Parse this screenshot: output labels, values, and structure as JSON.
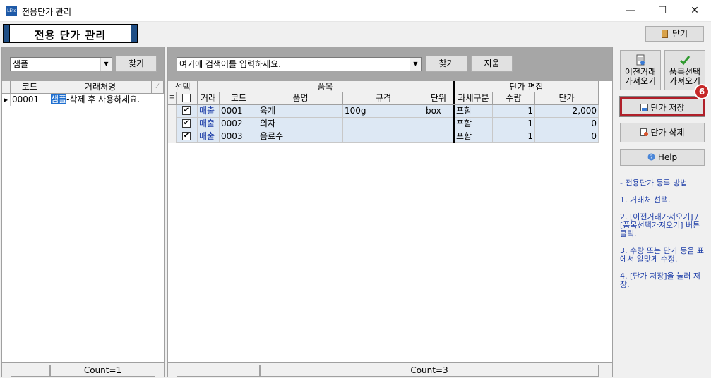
{
  "window": {
    "app_icon_text": "LEtc",
    "title": "전용단가 관리",
    "min_glyph": "—",
    "max_glyph": "☐",
    "close_glyph": "✕"
  },
  "header": {
    "page_title": "전용 단가 관리",
    "close_label": "닫기"
  },
  "left": {
    "search_value": "샘플",
    "find_label": "찾기",
    "columns": [
      "코드",
      "거래처명"
    ],
    "rows": [
      {
        "code": "00001",
        "name_highlight": "샘플",
        "name_rest": "-삭제 후 사용하세요."
      }
    ],
    "count": "Count=1"
  },
  "center": {
    "search_placeholder": "여기에 검색어를 입력하세요.",
    "find_label": "찾기",
    "clear_label": "지움",
    "group_headers": {
      "select": "선택",
      "item": "품목",
      "price_edit": "단가 편집"
    },
    "columns": {
      "trade": "거래",
      "code": "코드",
      "name": "품명",
      "spec": "규격",
      "unit": "단위",
      "tax": "과세구분",
      "qty": "수량",
      "price": "단가"
    },
    "rows": [
      {
        "checked": true,
        "trade": "매출",
        "code": "0001",
        "name": "육계",
        "spec": "100g",
        "unit": "box",
        "tax": "포함",
        "qty": "1",
        "price": "2,000"
      },
      {
        "checked": true,
        "trade": "매출",
        "code": "0002",
        "name": "의자",
        "spec": "",
        "unit": "",
        "tax": "포함",
        "qty": "1",
        "price": "0"
      },
      {
        "checked": true,
        "trade": "매출",
        "code": "0003",
        "name": "음료수",
        "spec": "",
        "unit": "",
        "tax": "포함",
        "qty": "1",
        "price": "0"
      }
    ],
    "count": "Count=3"
  },
  "right": {
    "import_prev_label_1": "이전거래",
    "import_prev_label_2": "가져오기",
    "import_item_label_1": "품목선택",
    "import_item_label_2": "가져오기",
    "save_label": "단가 저장",
    "delete_label": "단가 삭제",
    "help_label": "Help",
    "badge": "6",
    "guide": [
      "- 전용단가 등록 방법",
      "1. 거래처 선택.",
      "2. [이전거래가져오기] / [품목선택가져오기] 버튼 클릭.",
      "3. 수량 또는 단가 등을 표에서 알맞게 수정.",
      "4. [단가 저장]을 눌러 저장."
    ]
  },
  "colors": {
    "accent_bar": "#1f4e85",
    "row_bg": "#dde8f4",
    "guide_text": "#1f3fa8",
    "highlight": "#c62828"
  }
}
